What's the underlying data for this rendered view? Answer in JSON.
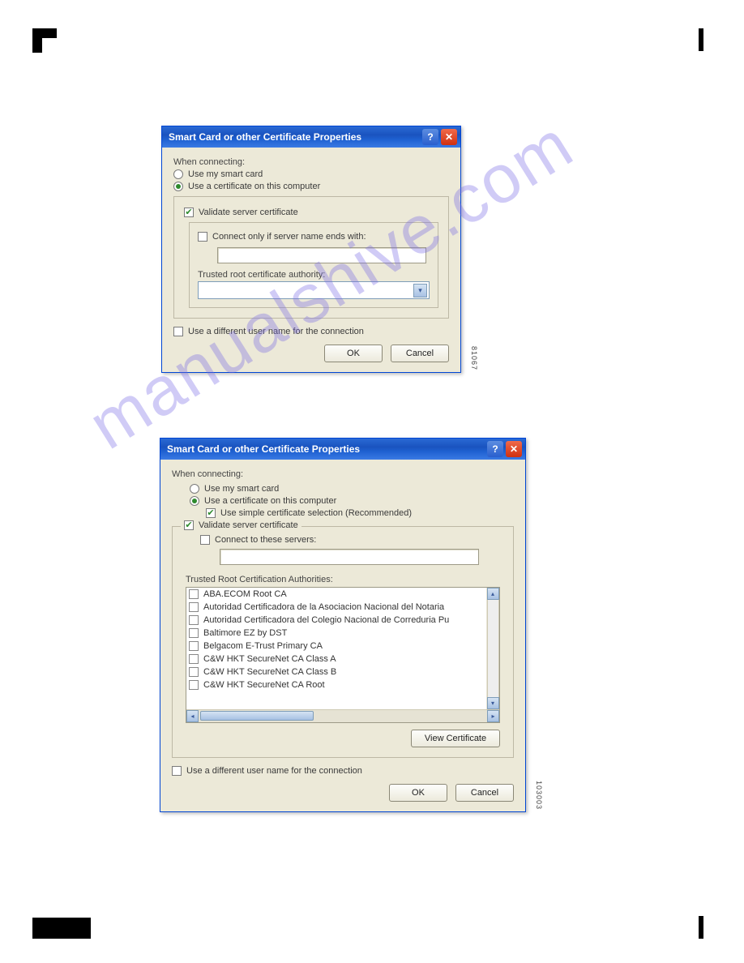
{
  "watermark": "manualshive.com",
  "dialog1": {
    "title": "Smart Card or other Certificate Properties",
    "when_connecting": "When connecting:",
    "radio_smartcard": "Use my smart card",
    "radio_cert": "Use a certificate on this computer",
    "validate": "Validate server certificate",
    "connect_only": "Connect only if server name ends with:",
    "trusted_label": "Trusted root certificate authority:",
    "diff_user": "Use a different user name for the connection",
    "ok": "OK",
    "cancel": "Cancel",
    "imgnum": "81067"
  },
  "dialog2": {
    "title": "Smart Card or other Certificate Properties",
    "when_connecting": "When connecting:",
    "radio_smartcard": "Use my smart card",
    "radio_cert": "Use a certificate on this computer",
    "simple_sel": "Use simple certificate selection (Recommended)",
    "validate": "Validate server certificate",
    "connect_servers": "Connect to these servers:",
    "trusted_label": "Trusted Root Certification Authorities:",
    "ca_list": [
      "ABA.ECOM Root CA",
      "Autoridad Certificadora de la Asociacion Nacional del Notaria",
      "Autoridad Certificadora del Colegio Nacional de Correduria Pu",
      "Baltimore EZ by DST",
      "Belgacom E-Trust Primary CA",
      "C&W HKT SecureNet CA Class A",
      "C&W HKT SecureNet CA Class B",
      "C&W HKT SecureNet CA Root"
    ],
    "view_cert": "View Certificate",
    "diff_user": "Use a different user name for the connection",
    "ok": "OK",
    "cancel": "Cancel",
    "imgnum": "103003"
  }
}
